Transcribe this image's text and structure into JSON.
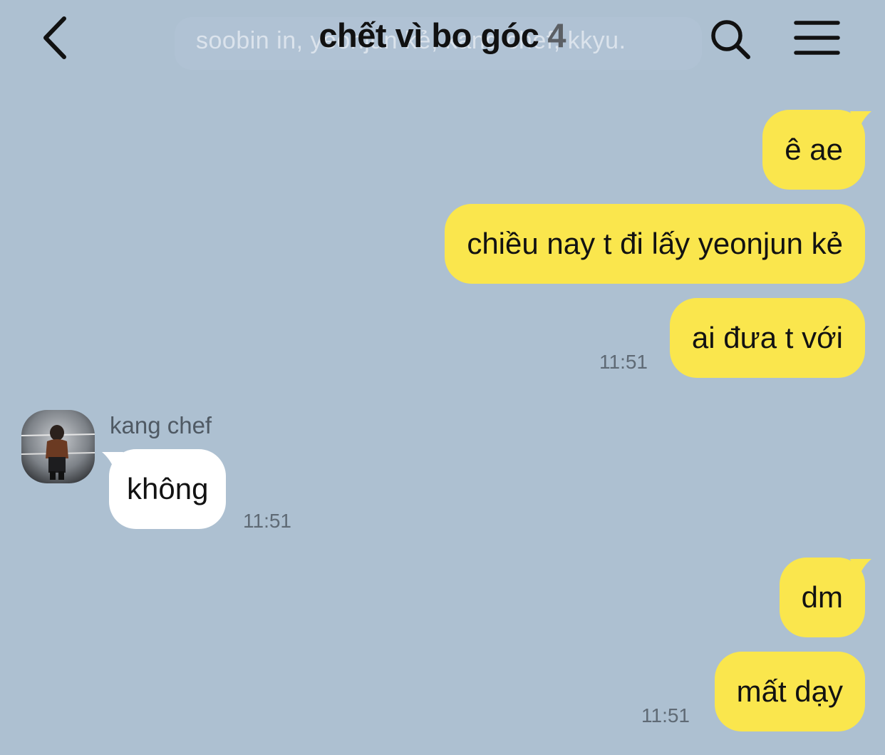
{
  "header": {
    "title": "chết vì bo góc",
    "member_count": "4",
    "members_preview": "soobin in, yeonjun kẻ, kang chef, kkyu.",
    "back_icon": "chevron-left-icon",
    "search_icon": "search-icon",
    "menu_icon": "hamburger-menu-icon"
  },
  "colors": {
    "background": "#adc0d1",
    "outgoing_bubble": "#fae64d",
    "incoming_bubble": "#ffffff",
    "text": "#121212",
    "timestamp": "#5f6a75"
  },
  "messages": [
    {
      "direction": "out",
      "text": "ê ae"
    },
    {
      "direction": "out",
      "text": "chiều nay t đi lấy yeonjun kẻ"
    },
    {
      "direction": "out",
      "text": "ai đưa t với",
      "time": "11:51"
    },
    {
      "direction": "in",
      "sender": "kang chef",
      "text": "không",
      "time": "11:51"
    },
    {
      "direction": "out",
      "text": "dm"
    },
    {
      "direction": "out",
      "text": "mất dạy",
      "time": "11:51"
    }
  ]
}
